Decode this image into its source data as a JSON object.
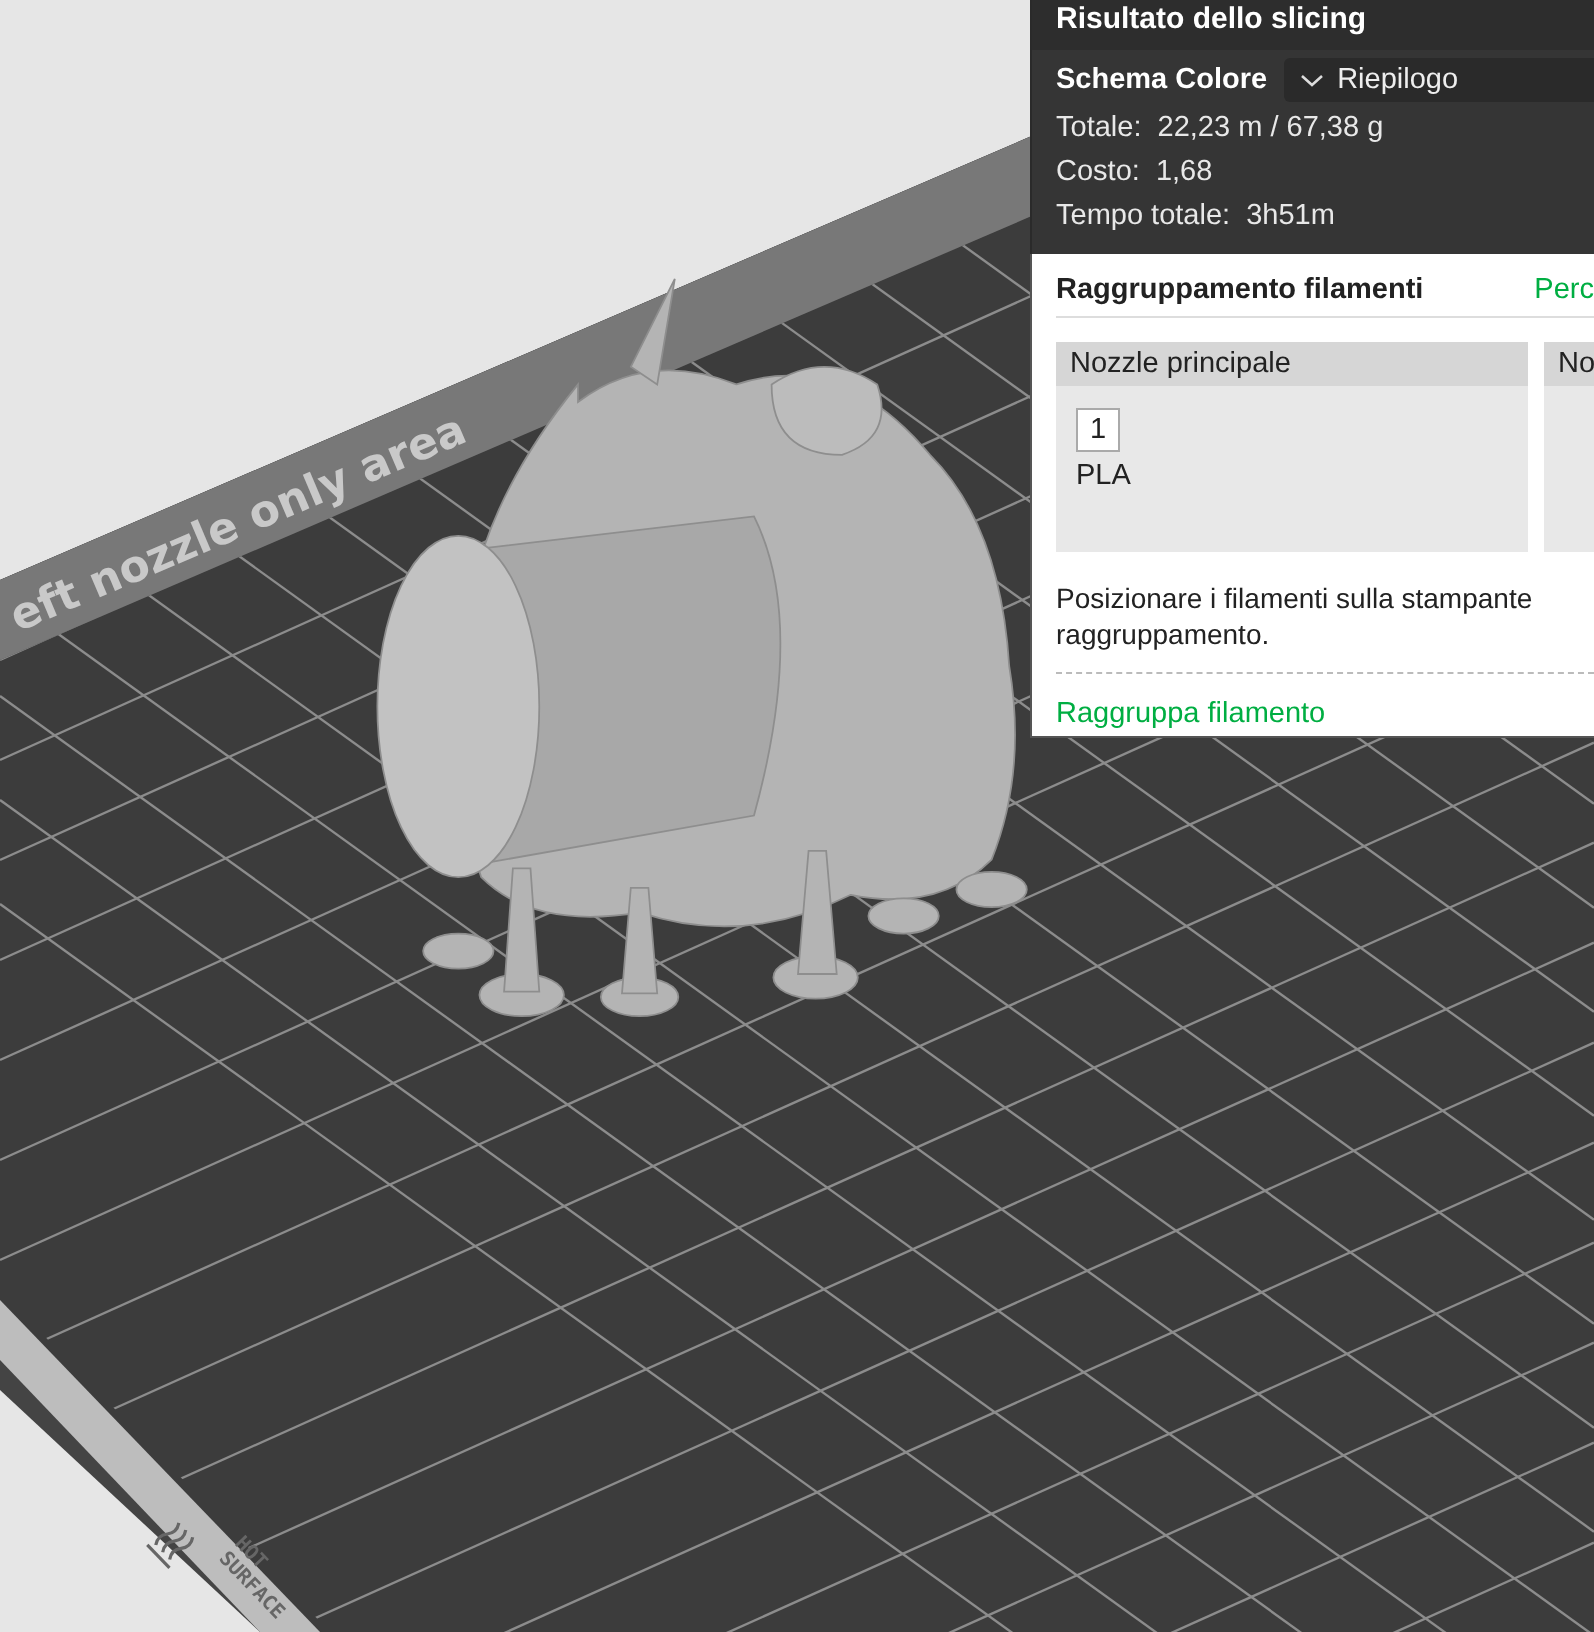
{
  "plate": {
    "strip_label": "eft nozzle only area",
    "warning_label": [
      "HOT",
      "SURFACE"
    ]
  },
  "slicing_panel": {
    "title": "Risultato dello slicing",
    "color_scheme": {
      "label": "Schema Colore",
      "value": "Riepilogo"
    },
    "stats": [
      {
        "label": "Totale:",
        "value": "22,23 m / 67,38 g"
      },
      {
        "label": "Costo:",
        "value": "1,68"
      },
      {
        "label": "Tempo totale:",
        "value": "3h51m"
      }
    ]
  },
  "filament_grouping": {
    "title": "Raggruppamento filamenti",
    "link": "Perc",
    "nozzles": [
      {
        "title": "Nozzle principale",
        "filaments": [
          {
            "number": "1",
            "material": "PLA"
          }
        ]
      },
      {
        "title": "No"
      }
    ],
    "description_lines": [
      "Posizionare i filamenti sulla stampante",
      "raggruppamento."
    ],
    "action_link": "Raggruppa filamento"
  }
}
